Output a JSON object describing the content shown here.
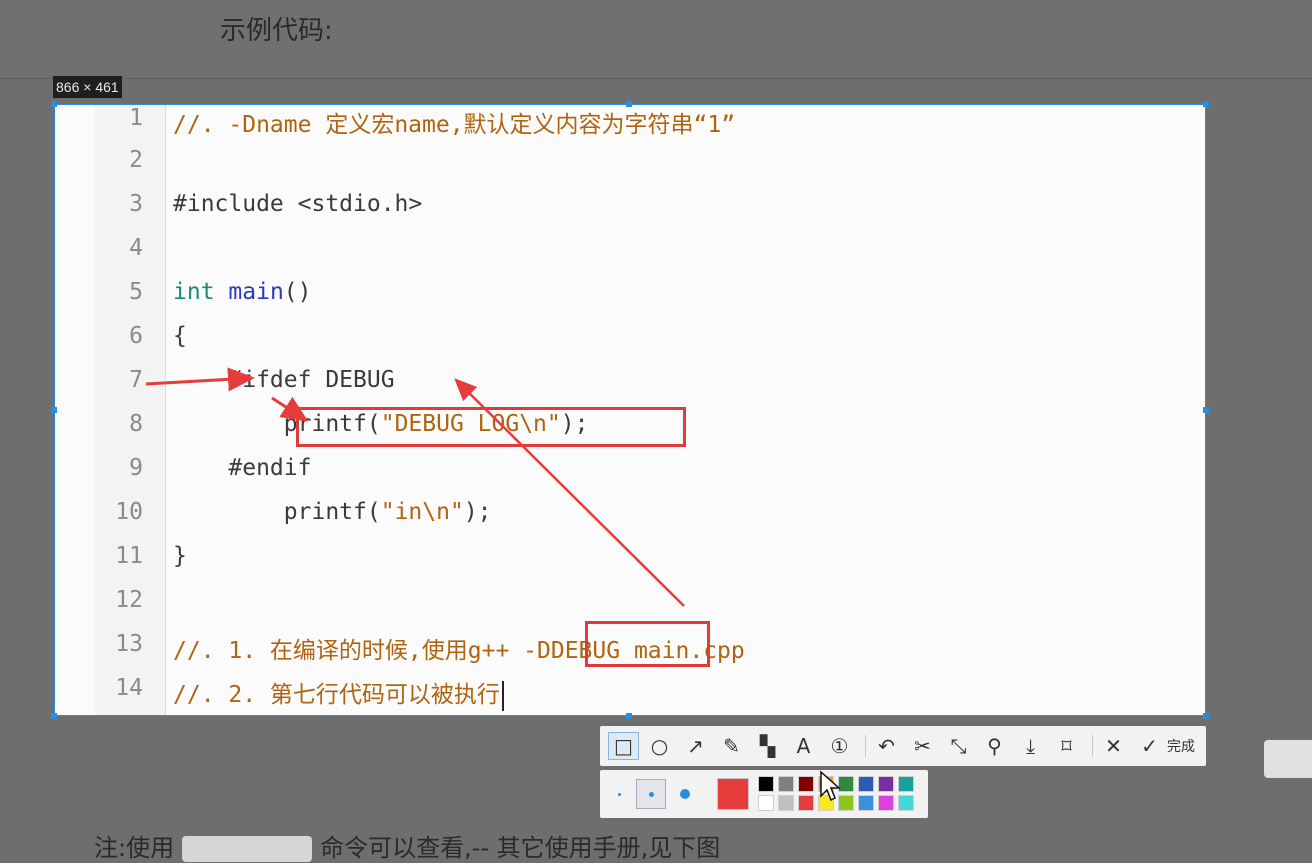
{
  "page": {
    "heading": "示例代码:"
  },
  "capture": {
    "size_label": "866 × 461"
  },
  "code_lines": [
    {
      "num": "1",
      "text": "//. -Dname 定义宏name,默认定义内容为字符串“1”"
    },
    {
      "num": "2",
      "text": ""
    },
    {
      "num": "3",
      "text": "#include <stdio.h>"
    },
    {
      "num": "4",
      "text": ""
    },
    {
      "num": "5",
      "kw": "int",
      "fn": "main",
      "rest": "()"
    },
    {
      "num": "6",
      "text": "{"
    },
    {
      "num": "7",
      "text": "    #ifdef DEBUG"
    },
    {
      "num": "8",
      "pre": "        printf(",
      "str": "\"DEBUG LOG\\n\"",
      "post": ");"
    },
    {
      "num": "9",
      "text": "    #endif"
    },
    {
      "num": "10",
      "pre": "        printf(",
      "str": "\"in\\n\"",
      "post": ");"
    },
    {
      "num": "11",
      "text": "}"
    },
    {
      "num": "12",
      "text": ""
    },
    {
      "num": "13",
      "c1": "//. 1. 在编译的时候,使用g++ ",
      "c2": "-DDEBUG",
      "c3": " main.cpp"
    },
    {
      "num": "14",
      "text": "//. 2. 第七行代码可以被执行"
    }
  ],
  "toolbar": {
    "tools": [
      {
        "name": "rectangle-tool-button",
        "icon": "□"
      },
      {
        "name": "ellipse-tool-button",
        "icon": "○"
      },
      {
        "name": "arrow-tool-button",
        "icon": "↗"
      },
      {
        "name": "pen-tool-button",
        "icon": "✎"
      },
      {
        "name": "mosaic-tool-button",
        "icon": "▚"
      },
      {
        "name": "text-tool-button",
        "icon": "A"
      },
      {
        "name": "number-marker-button",
        "icon": "①"
      }
    ],
    "actions": [
      {
        "name": "undo-button",
        "icon": "↶"
      },
      {
        "name": "cut-button",
        "icon": "✂"
      },
      {
        "name": "scroll-capture-button",
        "icon": "⤡"
      },
      {
        "name": "pin-button",
        "icon": "⚲"
      },
      {
        "name": "download-button",
        "icon": "⤓"
      },
      {
        "name": "bookmark-button",
        "icon": "⌑"
      }
    ],
    "cancel_icon": "✕",
    "done_icon": "✓",
    "done_label": "完成"
  },
  "palette": {
    "current_color": "#e63c3c",
    "swatches_top": [
      "#000000",
      "#808080",
      "#800000",
      "#f0a030",
      "#2e8b3e",
      "#2e5bb8",
      "#7b2ea0",
      "#1aa0a0"
    ],
    "swatches_bottom": [
      "#ffffff",
      "#c0c0c0",
      "#e63c3c",
      "#f8e820",
      "#8ac820",
      "#3a90e0",
      "#e040e0",
      "#40d8d8"
    ]
  },
  "bottom_text": {
    "before": "注:使用",
    "after": "命令可以查看,-- 其它使用手册,见下图"
  }
}
